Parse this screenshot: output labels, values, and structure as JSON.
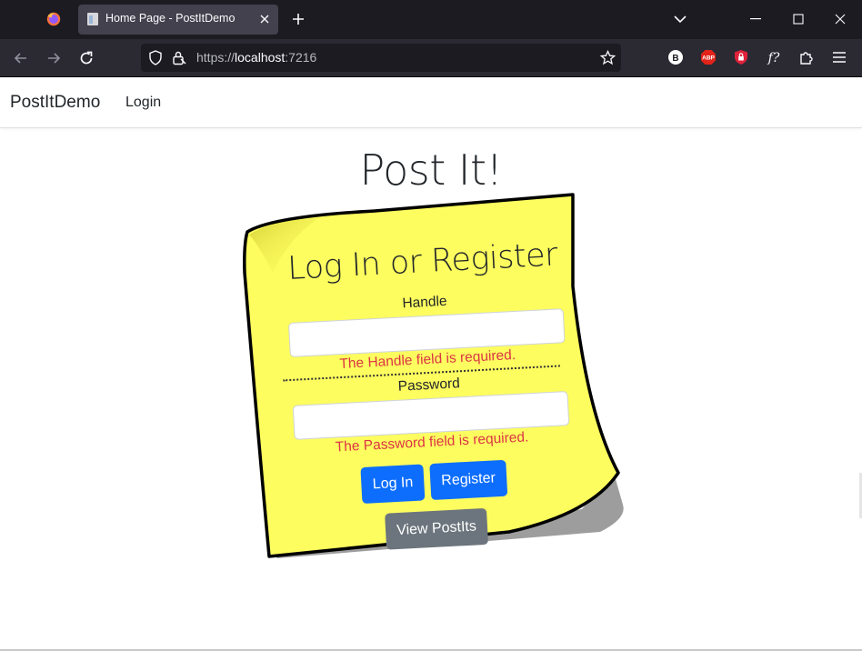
{
  "browser": {
    "tab_title": "Home Page - PostItDemo",
    "url_scheme": "https://",
    "url_host": "localhost",
    "url_port": ":7216",
    "extensions": [
      {
        "name": "b-extension-icon",
        "label": "B"
      },
      {
        "name": "adblock-plus-icon",
        "label": "ABP"
      },
      {
        "name": "privacy-shield-icon",
        "label": ""
      },
      {
        "name": "formula-icon",
        "label": "f?"
      }
    ]
  },
  "site": {
    "brand": "PostItDemo",
    "nav_login": "Login"
  },
  "page": {
    "title": "Post It!"
  },
  "note": {
    "color": "#fdfd5f",
    "heading": "Log In or Register",
    "handle_label": "Handle",
    "handle_value": "",
    "handle_error": "The Handle field is required.",
    "password_label": "Password",
    "password_value": "",
    "password_error": "The Password field is required.",
    "login_button": "Log In",
    "register_button": "Register",
    "view_button": "View PostIts"
  }
}
